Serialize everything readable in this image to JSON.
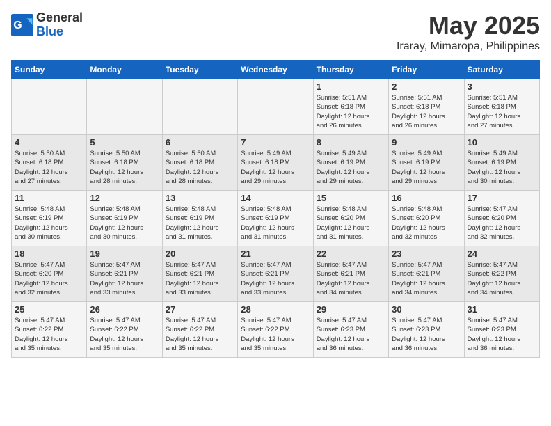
{
  "logo": {
    "general": "General",
    "blue": "Blue"
  },
  "title": "May 2025",
  "subtitle": "Iraray, Mimaropa, Philippines",
  "weekdays": [
    "Sunday",
    "Monday",
    "Tuesday",
    "Wednesday",
    "Thursday",
    "Friday",
    "Saturday"
  ],
  "weeks": [
    [
      {
        "day": "",
        "info": ""
      },
      {
        "day": "",
        "info": ""
      },
      {
        "day": "",
        "info": ""
      },
      {
        "day": "",
        "info": ""
      },
      {
        "day": "1",
        "info": "Sunrise: 5:51 AM\nSunset: 6:18 PM\nDaylight: 12 hours\nand 26 minutes."
      },
      {
        "day": "2",
        "info": "Sunrise: 5:51 AM\nSunset: 6:18 PM\nDaylight: 12 hours\nand 26 minutes."
      },
      {
        "day": "3",
        "info": "Sunrise: 5:51 AM\nSunset: 6:18 PM\nDaylight: 12 hours\nand 27 minutes."
      }
    ],
    [
      {
        "day": "4",
        "info": "Sunrise: 5:50 AM\nSunset: 6:18 PM\nDaylight: 12 hours\nand 27 minutes."
      },
      {
        "day": "5",
        "info": "Sunrise: 5:50 AM\nSunset: 6:18 PM\nDaylight: 12 hours\nand 28 minutes."
      },
      {
        "day": "6",
        "info": "Sunrise: 5:50 AM\nSunset: 6:18 PM\nDaylight: 12 hours\nand 28 minutes."
      },
      {
        "day": "7",
        "info": "Sunrise: 5:49 AM\nSunset: 6:18 PM\nDaylight: 12 hours\nand 29 minutes."
      },
      {
        "day": "8",
        "info": "Sunrise: 5:49 AM\nSunset: 6:19 PM\nDaylight: 12 hours\nand 29 minutes."
      },
      {
        "day": "9",
        "info": "Sunrise: 5:49 AM\nSunset: 6:19 PM\nDaylight: 12 hours\nand 29 minutes."
      },
      {
        "day": "10",
        "info": "Sunrise: 5:49 AM\nSunset: 6:19 PM\nDaylight: 12 hours\nand 30 minutes."
      }
    ],
    [
      {
        "day": "11",
        "info": "Sunrise: 5:48 AM\nSunset: 6:19 PM\nDaylight: 12 hours\nand 30 minutes."
      },
      {
        "day": "12",
        "info": "Sunrise: 5:48 AM\nSunset: 6:19 PM\nDaylight: 12 hours\nand 30 minutes."
      },
      {
        "day": "13",
        "info": "Sunrise: 5:48 AM\nSunset: 6:19 PM\nDaylight: 12 hours\nand 31 minutes."
      },
      {
        "day": "14",
        "info": "Sunrise: 5:48 AM\nSunset: 6:19 PM\nDaylight: 12 hours\nand 31 minutes."
      },
      {
        "day": "15",
        "info": "Sunrise: 5:48 AM\nSunset: 6:20 PM\nDaylight: 12 hours\nand 31 minutes."
      },
      {
        "day": "16",
        "info": "Sunrise: 5:48 AM\nSunset: 6:20 PM\nDaylight: 12 hours\nand 32 minutes."
      },
      {
        "day": "17",
        "info": "Sunrise: 5:47 AM\nSunset: 6:20 PM\nDaylight: 12 hours\nand 32 minutes."
      }
    ],
    [
      {
        "day": "18",
        "info": "Sunrise: 5:47 AM\nSunset: 6:20 PM\nDaylight: 12 hours\nand 32 minutes."
      },
      {
        "day": "19",
        "info": "Sunrise: 5:47 AM\nSunset: 6:21 PM\nDaylight: 12 hours\nand 33 minutes."
      },
      {
        "day": "20",
        "info": "Sunrise: 5:47 AM\nSunset: 6:21 PM\nDaylight: 12 hours\nand 33 minutes."
      },
      {
        "day": "21",
        "info": "Sunrise: 5:47 AM\nSunset: 6:21 PM\nDaylight: 12 hours\nand 33 minutes."
      },
      {
        "day": "22",
        "info": "Sunrise: 5:47 AM\nSunset: 6:21 PM\nDaylight: 12 hours\nand 34 minutes."
      },
      {
        "day": "23",
        "info": "Sunrise: 5:47 AM\nSunset: 6:21 PM\nDaylight: 12 hours\nand 34 minutes."
      },
      {
        "day": "24",
        "info": "Sunrise: 5:47 AM\nSunset: 6:22 PM\nDaylight: 12 hours\nand 34 minutes."
      }
    ],
    [
      {
        "day": "25",
        "info": "Sunrise: 5:47 AM\nSunset: 6:22 PM\nDaylight: 12 hours\nand 35 minutes."
      },
      {
        "day": "26",
        "info": "Sunrise: 5:47 AM\nSunset: 6:22 PM\nDaylight: 12 hours\nand 35 minutes."
      },
      {
        "day": "27",
        "info": "Sunrise: 5:47 AM\nSunset: 6:22 PM\nDaylight: 12 hours\nand 35 minutes."
      },
      {
        "day": "28",
        "info": "Sunrise: 5:47 AM\nSunset: 6:22 PM\nDaylight: 12 hours\nand 35 minutes."
      },
      {
        "day": "29",
        "info": "Sunrise: 5:47 AM\nSunset: 6:23 PM\nDaylight: 12 hours\nand 36 minutes."
      },
      {
        "day": "30",
        "info": "Sunrise: 5:47 AM\nSunset: 6:23 PM\nDaylight: 12 hours\nand 36 minutes."
      },
      {
        "day": "31",
        "info": "Sunrise: 5:47 AM\nSunset: 6:23 PM\nDaylight: 12 hours\nand 36 minutes."
      }
    ]
  ]
}
